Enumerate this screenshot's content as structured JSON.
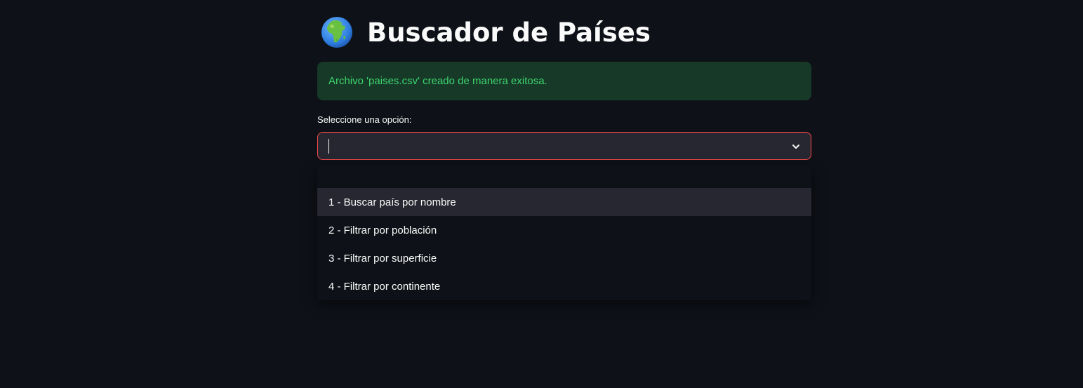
{
  "header": {
    "icon": "globe-africa-icon",
    "title": "Buscador de Países"
  },
  "alert": {
    "message": "Archivo 'paises.csv' creado de manera exitosa.",
    "color": "#3dd56d",
    "background": "#173928"
  },
  "select": {
    "label": "Seleccione una opción:",
    "value": "",
    "focus_border_color": "#ff4b4b",
    "options": [
      {
        "label": "1 - Buscar país por nombre",
        "highlighted": true
      },
      {
        "label": "2 - Filtrar por población",
        "highlighted": false
      },
      {
        "label": "3 - Filtrar por superficie",
        "highlighted": false
      },
      {
        "label": "4 - Filtrar por continente",
        "highlighted": false
      }
    ]
  }
}
